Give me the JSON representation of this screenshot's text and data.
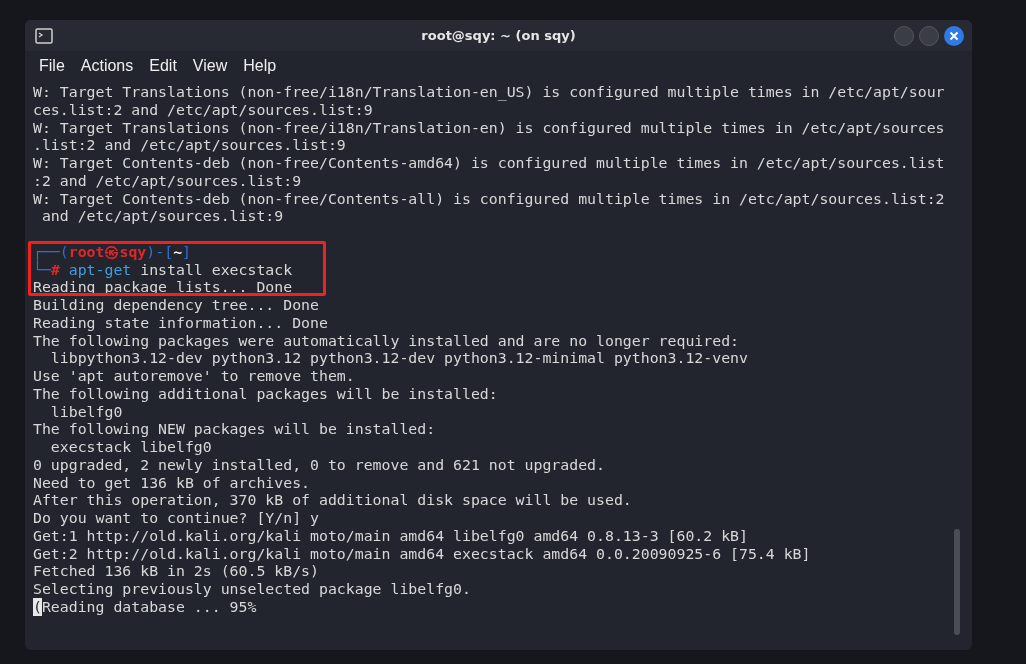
{
  "window": {
    "title": "root@sqy: ~ (on sqy)"
  },
  "menu": [
    "File",
    "Actions",
    "Edit",
    "View",
    "Help"
  ],
  "terminal": {
    "lines": [
      {
        "kind": "text",
        "text": "W: Target Translations (non-free/i18n/Translation-en_US) is configured multiple times in /etc/apt/sour"
      },
      {
        "kind": "text",
        "text": "ces.list:2 and /etc/apt/sources.list:9"
      },
      {
        "kind": "text",
        "text": "W: Target Translations (non-free/i18n/Translation-en) is configured multiple times in /etc/apt/sources"
      },
      {
        "kind": "text",
        "text": ".list:2 and /etc/apt/sources.list:9"
      },
      {
        "kind": "text",
        "text": "W: Target Contents-deb (non-free/Contents-amd64) is configured multiple times in /etc/apt/sources.list"
      },
      {
        "kind": "text",
        "text": ":2 and /etc/apt/sources.list:9"
      },
      {
        "kind": "text",
        "text": "W: Target Contents-deb (non-free/Contents-all) is configured multiple times in /etc/apt/sources.list:2"
      },
      {
        "kind": "text",
        "text": " and /etc/apt/sources.list:9"
      },
      {
        "kind": "blank"
      },
      {
        "kind": "prompt",
        "open": "┌──(",
        "user_host": "root㉿sqy",
        "mid": ")-[",
        "dir": "~",
        "close": "]"
      },
      {
        "kind": "command",
        "corner": "└─",
        "hash": "#",
        "command": "apt-get",
        "args": "install execstack"
      },
      {
        "kind": "text",
        "text": "Reading package lists... Done"
      },
      {
        "kind": "text",
        "text": "Building dependency tree... Done"
      },
      {
        "kind": "text",
        "text": "Reading state information... Done"
      },
      {
        "kind": "text",
        "text": "The following packages were automatically installed and are no longer required:"
      },
      {
        "kind": "text",
        "text": "  libpython3.12-dev python3.12 python3.12-dev python3.12-minimal python3.12-venv"
      },
      {
        "kind": "text",
        "text": "Use 'apt autoremove' to remove them."
      },
      {
        "kind": "text",
        "text": "The following additional packages will be installed:"
      },
      {
        "kind": "text",
        "text": "  libelfg0"
      },
      {
        "kind": "text",
        "text": "The following NEW packages will be installed:"
      },
      {
        "kind": "text",
        "text": "  execstack libelfg0"
      },
      {
        "kind": "text",
        "text": "0 upgraded, 2 newly installed, 0 to remove and 621 not upgraded."
      },
      {
        "kind": "text",
        "text": "Need to get 136 kB of archives."
      },
      {
        "kind": "text",
        "text": "After this operation, 370 kB of additional disk space will be used."
      },
      {
        "kind": "text",
        "text": "Do you want to continue? [Y/n] y"
      },
      {
        "kind": "text",
        "text": "Get:1 http://old.kali.org/kali moto/main amd64 libelfg0 amd64 0.8.13-3 [60.2 kB]"
      },
      {
        "kind": "text",
        "text": "Get:2 http://old.kali.org/kali moto/main amd64 execstack amd64 0.0.20090925-6 [75.4 kB]"
      },
      {
        "kind": "text",
        "text": "Fetched 136 kB in 2s (60.5 kB/s)"
      },
      {
        "kind": "text",
        "text": "Selecting previously unselected package libelfg0."
      },
      {
        "kind": "cursor",
        "cursor": "(",
        "text": "Reading database ... 95%"
      }
    ]
  }
}
